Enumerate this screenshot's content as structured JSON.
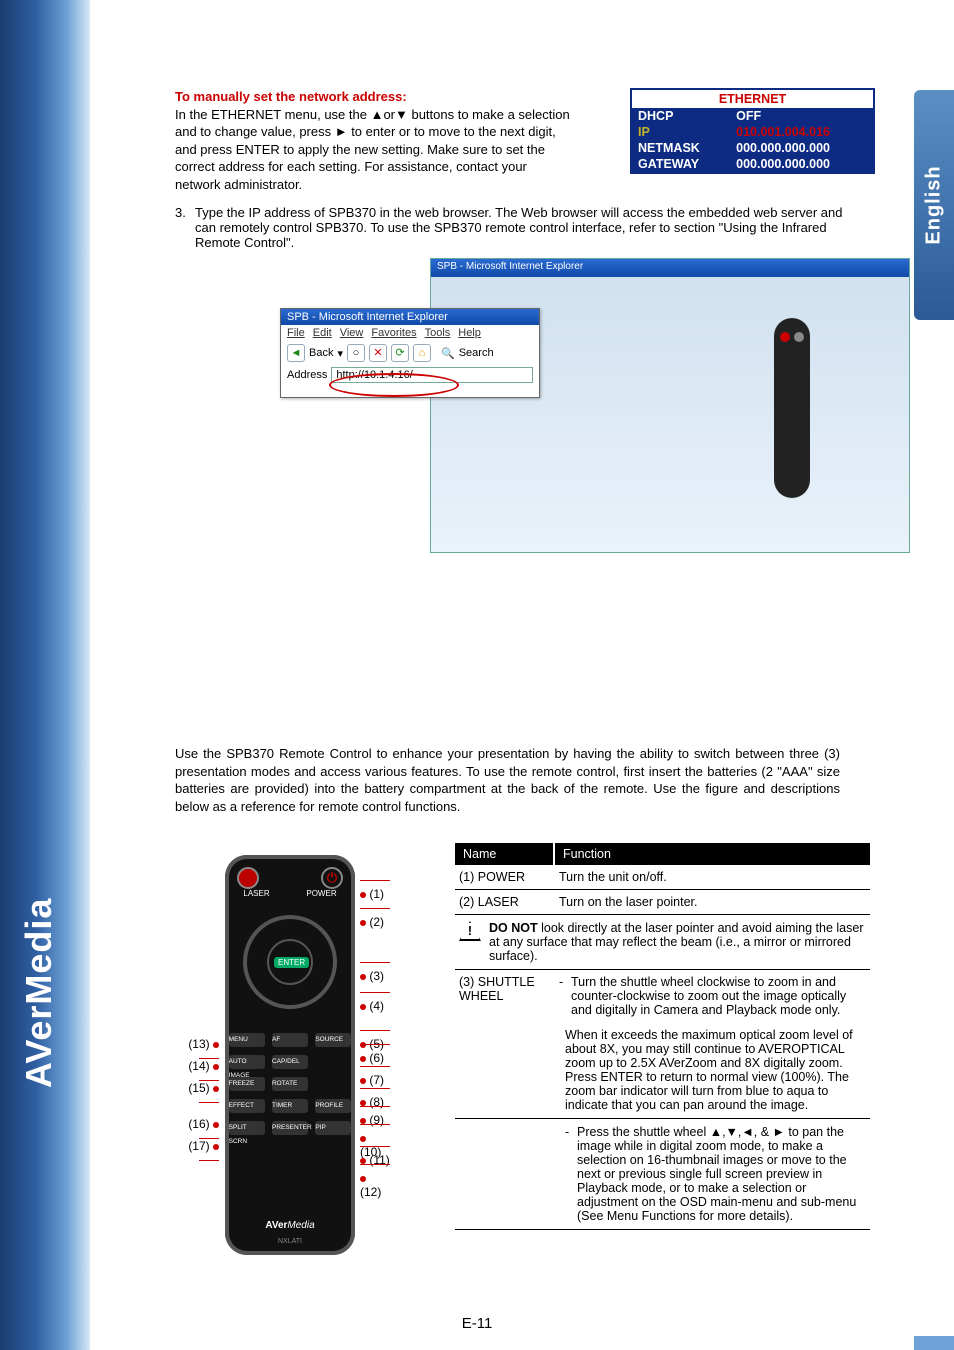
{
  "brand_side": "AVerMedia",
  "lang_tab": "English",
  "page_number": "E-11",
  "section1": {
    "heading": "To manually set the network address:",
    "body": "In the ETHERNET menu, use the ▲or▼ buttons to make a selection and to change value, press ► to enter or to move to the next digit, and press ENTER to apply the new setting. Make sure to set the correct address for each setting. For assistance, contact your network administrator."
  },
  "ethernet_table": {
    "title": "ETHERNET",
    "rows": [
      {
        "label": "DHCP",
        "value": "OFF",
        "hl": false
      },
      {
        "label": "IP",
        "value": "010.001.004.016",
        "hl": true
      },
      {
        "label": "NETMASK",
        "value": "000.000.000.000",
        "hl": false
      },
      {
        "label": "GATEWAY",
        "value": "000.000.000.000",
        "hl": false
      }
    ]
  },
  "step3": {
    "num": "3.",
    "text": "Type the IP address of SPB370 in the web browser. The Web browser will access the embedded web server and can remotely control SPB370. To use the SPB370 remote control interface, refer to section \"Using the Infrared Remote Control\"."
  },
  "ie_popup": {
    "title": "SPB - Microsoft Internet Explorer",
    "menu": [
      "File",
      "Edit",
      "View",
      "Favorites",
      "Tools",
      "Help"
    ],
    "back": "Back",
    "search": "Search",
    "address_label": "Address",
    "url": "http://10.1.4.16/"
  },
  "remote_intro": "Use the SPB370 Remote Control to enhance your presentation by having the ability to switch between three (3) presentation modes and access various features. To use the remote control, first insert the batteries (2 \"AAA\" size batteries are provided) into the battery compartment at the back of the remote. Use the figure and descriptions below as a reference for remote control functions.",
  "remote_labels_top": {
    "laser": "LASER",
    "power": "POWER"
  },
  "remote_buttons": {
    "r1": [
      "MENU",
      "AF",
      "SOURCE"
    ],
    "r2": [
      "AUTO IMAGE",
      "CAP/DEL",
      ""
    ],
    "r3": [
      "FREEZE",
      "ROTATE",
      ""
    ],
    "r4": [
      "EFFECT",
      "TIMER",
      "PROFILE"
    ],
    "r5": [
      "SPLIT SCRN",
      "PRESENTER",
      "PIP"
    ]
  },
  "remote_brand": "AVerMedia",
  "remote_model": "NXLATI",
  "callouts_right": [
    "(1)",
    "(2)",
    "(3)",
    "(4)",
    "(5)",
    "(6)",
    "(7)",
    "(8)",
    "(9)",
    "(10)",
    "(11)",
    "(12)"
  ],
  "callouts_left": [
    "(13)",
    "(14)",
    "(15)",
    "(16)",
    "(17)"
  ],
  "fn_table": {
    "head": {
      "c1": "Name",
      "c2": "Function"
    },
    "rows": [
      {
        "c1": "(1) POWER",
        "c2": "Turn the unit on/off."
      },
      {
        "c1": "(2) LASER",
        "c2": "Turn on the laser pointer."
      }
    ],
    "warning": "DO NOT look directly at the laser pointer and avoid aiming the laser at any surface that may reflect the beam (i.e., a mirror or mirrored surface).",
    "shuttle_name": "(3) SHUTTLE WHEEL",
    "shuttle_a": "Turn the shuttle wheel clockwise to zoom in and counter-clockwise to zoom out the image optically and digitally in Camera and Playback mode only.",
    "shuttle_b": "When it exceeds the maximum optical zoom level of about 8X, you may still continue to AVEROPTICAL zoom up to 2.5X AVerZoom and 8X digitally zoom. Press ENTER to return to normal view (100%). The zoom bar indicator will turn from blue to aqua to indicate that you can pan around the image.",
    "shuttle_c": "Press the shuttle wheel ▲,▼,◄, & ► to pan the image while in digital zoom mode, to make a selection on 16-thumbnail images or move to the next or previous single full screen preview in Playback mode, or to make a selection or adjustment on the OSD main-menu and sub-menu (See Menu Functions for more details)."
  }
}
